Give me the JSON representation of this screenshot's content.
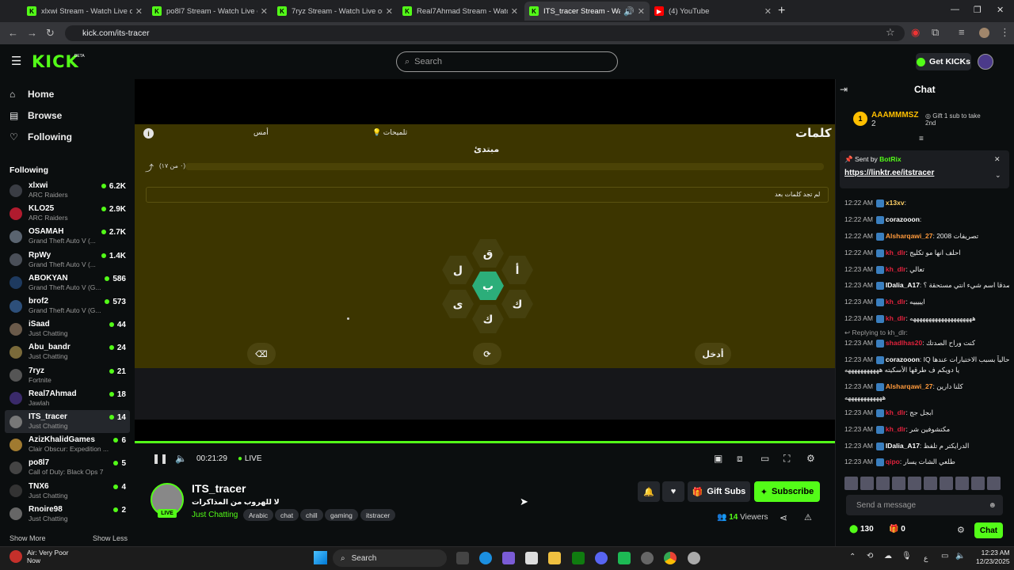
{
  "tabs": [
    {
      "title": "xlxwi Stream - Watch Live on Kick",
      "icon": "kick-icon"
    },
    {
      "title": "po8l7 Stream - Watch Live on Kick",
      "icon": "kick-icon"
    },
    {
      "title": "7ryz Stream - Watch Live on Kick",
      "icon": "kick-icon"
    },
    {
      "title": "Real7Ahmad Stream - Watch Live on Kick",
      "icon": "kick-icon"
    },
    {
      "title": "ITS_tracer Stream - Watch Live on Kick",
      "icon": "kick-icon"
    },
    {
      "title": "(4) YouTube",
      "icon": "youtube-icon"
    }
  ],
  "address": "kick.com/its-tracer",
  "header": {
    "logo": "KICK",
    "beta": "BETA",
    "search_placeholder": "Search",
    "get_kicks": "Get KICKs"
  },
  "sidebar": {
    "nav": [
      {
        "label": "Home",
        "icon": "home-icon"
      },
      {
        "label": "Browse",
        "icon": "browse-icon"
      },
      {
        "label": "Following",
        "icon": "heart-icon"
      }
    ],
    "following_title": "Following",
    "channels": [
      {
        "name": "xlxwi",
        "category": "ARC Raiders",
        "viewers": "6.2K"
      },
      {
        "name": "KLO25",
        "category": "ARC Raiders",
        "viewers": "2.9K"
      },
      {
        "name": "OSAMAH",
        "category": "Grand Theft Auto V (...",
        "viewers": "2.7K"
      },
      {
        "name": "RpWy",
        "category": "Grand Theft Auto V (...",
        "viewers": "1.4K"
      },
      {
        "name": "ABOKYAN",
        "category": "Grand Theft Auto V (G...",
        "viewers": "586"
      },
      {
        "name": "brof2",
        "category": "Grand Theft Auto V (G...",
        "viewers": "573"
      },
      {
        "name": "iSaad",
        "category": "Just Chatting",
        "viewers": "44"
      },
      {
        "name": "Abu_bandr",
        "category": "Just Chatting",
        "viewers": "24"
      },
      {
        "name": "7ryz",
        "category": "Fortnite",
        "viewers": "21"
      },
      {
        "name": "Real7Ahmad",
        "category": "Jawlah",
        "viewers": "18"
      },
      {
        "name": "ITS_tracer",
        "category": "Just Chatting",
        "viewers": "14"
      },
      {
        "name": "AzizKhalidGames",
        "category": "Clair Obscur: Expedition ...",
        "viewers": "6"
      },
      {
        "name": "po8l7",
        "category": "Call of Duty: Black Ops 7",
        "viewers": "5"
      },
      {
        "name": "TNX6",
        "category": "Just Chatting",
        "viewers": "4"
      },
      {
        "name": "Rnoire98",
        "category": "Just Chatting",
        "viewers": "2"
      }
    ],
    "show_more": "Show More",
    "show_less": "Show Less"
  },
  "game": {
    "title": "كلمات",
    "hints": "تلميحات",
    "yesterday": "أمس",
    "level": "مبتدئ",
    "progress_text": "(٠ من ١٧)",
    "progress_fraction": 0.0,
    "no_words": "لم تجد كلمات بعد",
    "letters": {
      "center": "ب",
      "top": "ق",
      "top_left": "ل",
      "top_right": "أ",
      "bottom_left": "ى",
      "bottom_right": "ك",
      "bottom": "ك"
    },
    "enter": "أدخل"
  },
  "player": {
    "time": "00:21:29",
    "live": "LIVE"
  },
  "stream": {
    "channel": "ITS_tracer",
    "live_badge": "LIVE",
    "title": "لا للهروب من المذاكرات",
    "category": "Just Chatting",
    "tags": [
      "Arabic",
      "chat",
      "chill",
      "gaming",
      "itstracer"
    ],
    "gift_subs": "Gift Subs",
    "subscribe": "Subscribe",
    "viewers_count": "14",
    "viewers_label": "Viewers"
  },
  "chat": {
    "title": "Chat",
    "top_gifter": {
      "rank": "1",
      "name": "AAAMMMSZ",
      "count": "2"
    },
    "gift_prompt": "Gift 1 sub to take 2nd",
    "pinned": {
      "sent_by": "Sent by",
      "sender": "BotRix",
      "link": "https://linktr.ee/itstracer"
    },
    "messages": [
      {
        "time": "12:22 AM",
        "user": "x13xv",
        "text": "",
        "color": "#ffd166"
      },
      {
        "time": "12:22 AM",
        "user": "corazooon",
        "text": "",
        "color": "#ffffff"
      },
      {
        "time": "12:22 AM",
        "user": "Alsharqawi_27",
        "text": "تصريفات 2008",
        "color": "#ff9a3c"
      },
      {
        "time": "12:22 AM",
        "user": "kh_dlr",
        "text": "احلف انها مو تكليج",
        "color": "#e0223c"
      },
      {
        "time": "12:23 AM",
        "user": "kh_dlr",
        "text": "تعالي",
        "color": "#e0223c"
      },
      {
        "time": "12:23 AM",
        "user": "IDalia_A17",
        "text": "صدقا صدقا اسم شيء انتي مستحقة ؟",
        "color": "#ffffff"
      },
      {
        "time": "12:23 AM",
        "user": "kh_dlr",
        "text": "ايييييه",
        "color": "#e0223c"
      },
      {
        "time": "12:23 AM",
        "user": "kh_dlr",
        "text": "ههههههههههههههههههههه",
        "color": "#e0223c"
      },
      {
        "time": "12:23 AM",
        "user": "shadlhas20",
        "text": "كنت وراح الصدتك",
        "color": "#e0223c"
      },
      {
        "time": "12:23 AM",
        "user": "corazooon",
        "text": "IQ هي حالياً بسبب الاختبارات عندها",
        "color": "#ffffff"
      },
      {
        "time": "12:23 AM",
        "user": "Alsharqawi_27",
        "text": "كلنا دارين",
        "color": "#ff9a3c"
      },
      {
        "time": "12:23 AM",
        "user": "kh_dlr",
        "text": "ابجل جج",
        "color": "#e0223c"
      },
      {
        "time": "12:23 AM",
        "user": "kh_dlr",
        "text": "مكتشوفين شر",
        "color": "#e0223c"
      },
      {
        "time": "12:23 AM",
        "user": "IDalia_A17",
        "text": "الدرايكتر م تلفظ",
        "color": "#ffffff"
      },
      {
        "time": "12:23 AM",
        "user": "qipo",
        "text": "طلعي الشات يسار",
        "color": "#e0223c"
      }
    ],
    "replying": "Replying to kh_dlr:",
    "continuation_1": "يا دويكم ف طرقها الأسكيته هههههههههههه",
    "continuation_2": "ههههههههههههه",
    "send_placeholder": "Send a message",
    "points": "130",
    "zero": "0",
    "chat_button": "Chat"
  },
  "taskbar": {
    "weather_title": "Air: Very Poor",
    "weather_sub": "Now",
    "search": "Search",
    "lang": "ع",
    "time": "12:23 AM",
    "date": "12/23/2025"
  }
}
